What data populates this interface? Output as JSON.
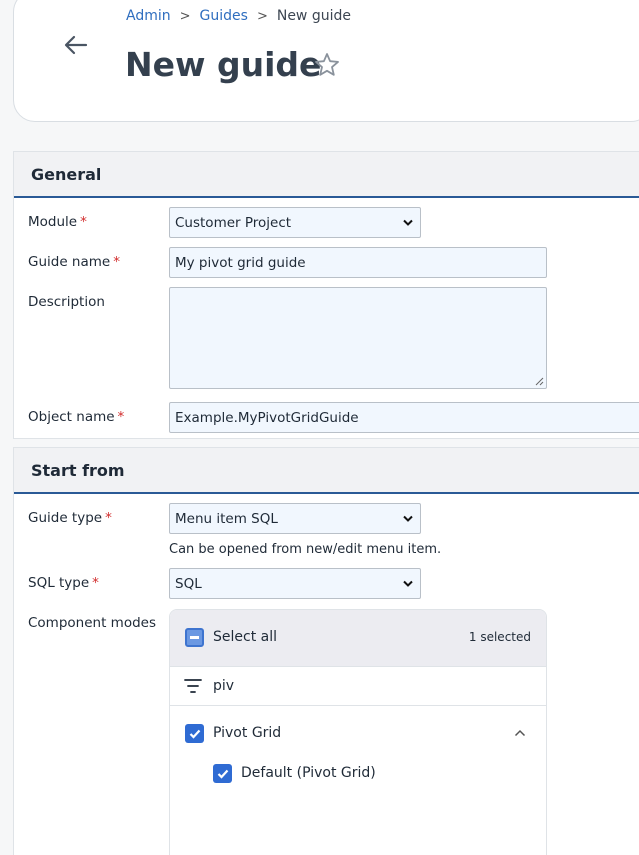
{
  "breadcrumb": {
    "items": [
      {
        "label": "Admin"
      },
      {
        "label": "Guides"
      }
    ],
    "current": "New guide",
    "separator": ">"
  },
  "page": {
    "title": "New guide"
  },
  "general": {
    "heading": "General",
    "module": {
      "label": "Module",
      "value": "Customer Project"
    },
    "guide_name": {
      "label": "Guide name",
      "value": "My pivot grid guide"
    },
    "description": {
      "label": "Description",
      "value": ""
    },
    "object_name": {
      "label": "Object name",
      "value": "Example.MyPivotGridGuide"
    },
    "required_mark": "*"
  },
  "start_from": {
    "heading": "Start from",
    "guide_type": {
      "label": "Guide type",
      "value": "Menu item SQL",
      "helper": "Can be opened from new/edit menu item."
    },
    "sql_type": {
      "label": "SQL type",
      "value": "SQL"
    },
    "component_modes": {
      "label": "Component modes",
      "select_all": "Select all",
      "selected_count": "1 selected",
      "filter_text": "piv",
      "groups": [
        {
          "label": "Pivot Grid",
          "checked": true,
          "expanded": true,
          "children": [
            {
              "label": "Default (Pivot Grid)",
              "checked": true
            }
          ]
        }
      ]
    }
  },
  "colors": {
    "accent": "#2f6bd3",
    "link": "#2f6ebf",
    "section_border": "#2a5a96",
    "required": "#d12b2b"
  },
  "icons": [
    "back-arrow-icon",
    "star-icon",
    "chevron-down-icon",
    "filter-icon",
    "check-icon",
    "minus-icon",
    "chevron-up-icon",
    "resize-handle-icon"
  ]
}
